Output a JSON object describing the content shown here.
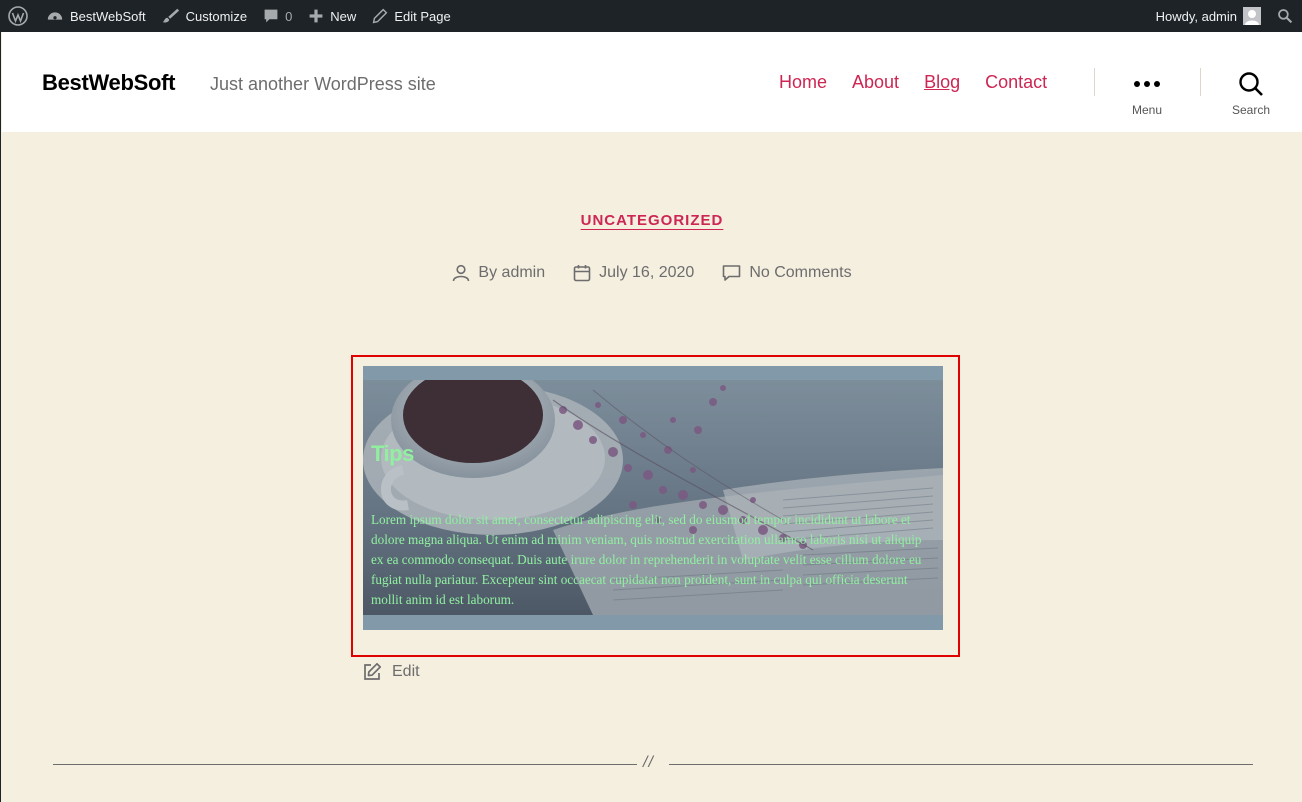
{
  "admin_bar": {
    "site_name": "BestWebSoft",
    "customize": "Customize",
    "comments_count": "0",
    "new": "New",
    "edit_page": "Edit Page",
    "howdy": "Howdy, admin"
  },
  "header": {
    "site_title": "BestWebSoft",
    "site_description": "Just another WordPress site",
    "nav": [
      "Home",
      "About",
      "Blog",
      "Contact"
    ],
    "current_nav": "Blog",
    "menu_label": "Menu",
    "search_label": "Search"
  },
  "entry": {
    "category": "UNCATEGORIZED",
    "author": "By admin",
    "date": "July 16, 2020",
    "comments": "No Comments",
    "cover": {
      "title": "Tips",
      "text": "Lorem ipsum dolor sit amet, consectetur adipiscing elit, sed do eiusmod tempor incididunt ut labore et dolore magna aliqua. Ut enim ad minim veniam, quis nostrud exercitation ullamco laboris nisi ut aliquip ex ea commodo consequat. Duis aute irure dolor in reprehenderit in voluptate velit esse cillum dolore eu fugiat nulla pariatur. Excepteur sint occaecat cupidatat non proident, sunt in culpa qui officia deserunt mollit anim id est laborum."
    },
    "edit_label": "Edit"
  },
  "divider_mark": "//",
  "colors": {
    "accent": "#cd2653",
    "background": "#f5efe0",
    "admin_bar": "#1d2327",
    "cover_text": "#90f0a0",
    "highlight_border": "#e00000"
  }
}
